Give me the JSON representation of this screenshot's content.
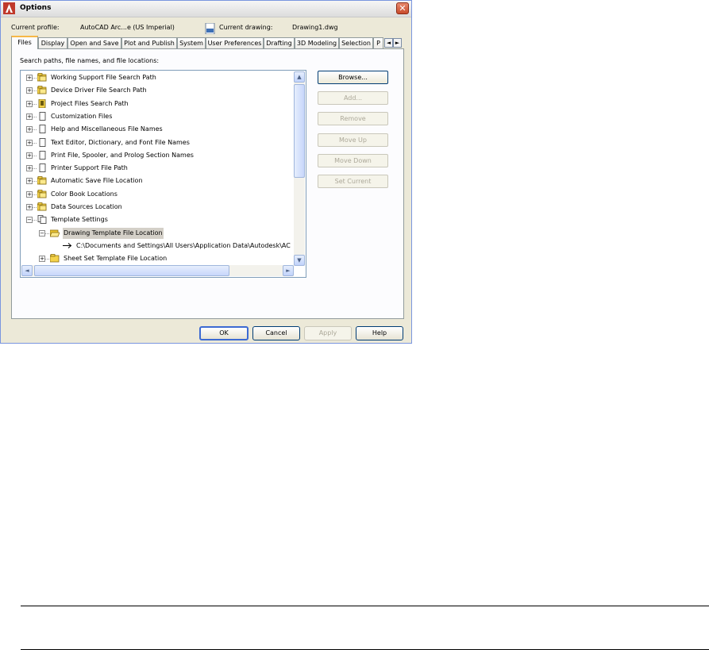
{
  "dialog": {
    "title": "Options",
    "current_profile_label": "Current profile:",
    "current_profile_value": "AutoCAD Arc...e (US Imperial)",
    "current_drawing_label": "Current drawing:",
    "current_drawing_value": "Drawing1.dwg"
  },
  "tabs": [
    "Files",
    "Display",
    "Open and Save",
    "Plot and Publish",
    "System",
    "User Preferences",
    "Drafting",
    "3D Modeling",
    "Selection",
    "P"
  ],
  "tab_scroll": {
    "left": "◄",
    "right": "►"
  },
  "panel": {
    "section_label": "Search paths, file names, and file locations:"
  },
  "tree": [
    {
      "label": "Working Support File Search Path",
      "icon": "folder-stack-icon",
      "expander": "+"
    },
    {
      "label": "Device Driver File Search Path",
      "icon": "folder-stack-icon",
      "expander": "+"
    },
    {
      "label": "Project Files Search Path",
      "icon": "project-file-icon",
      "expander": "+"
    },
    {
      "label": "Customization Files",
      "icon": "document-icon",
      "expander": "+"
    },
    {
      "label": "Help and Miscellaneous File Names",
      "icon": "document-icon",
      "expander": "+"
    },
    {
      "label": "Text Editor, Dictionary, and Font File Names",
      "icon": "document-icon",
      "expander": "+"
    },
    {
      "label": "Print File, Spooler, and Prolog Section Names",
      "icon": "document-icon",
      "expander": "+"
    },
    {
      "label": "Printer Support File Path",
      "icon": "document-icon",
      "expander": "+"
    },
    {
      "label": "Automatic Save File Location",
      "icon": "folder-stack-icon",
      "expander": "+"
    },
    {
      "label": "Color Book Locations",
      "icon": "folder-stack-icon",
      "expander": "+"
    },
    {
      "label": "Data Sources Location",
      "icon": "folder-stack-icon",
      "expander": "+"
    },
    {
      "label": "Template Settings",
      "icon": "template-documents-icon",
      "expander": "−"
    },
    {
      "label": "Drawing Template File Location",
      "icon": "open-folder-icon",
      "expander": "−",
      "selected": true
    },
    {
      "label": "C:\\Documents and Settings\\All Users\\Application Data\\Autodesk\\AC",
      "icon": "arrow-right-icon",
      "expander": ""
    },
    {
      "label": "Sheet Set Template File Location",
      "icon": "folder-icon",
      "expander": "+"
    }
  ],
  "side_buttons": {
    "browse": "Browse...",
    "add": "Add...",
    "remove": "Remove",
    "move_up": "Move Up",
    "move_down": "Move Down",
    "set_current": "Set Current"
  },
  "footer": {
    "ok": "OK",
    "cancel": "Cancel",
    "apply": "Apply",
    "help": "Help"
  },
  "colors": {
    "dialog_bg": "#ece9d8",
    "panel_bg": "#fcfcfe",
    "folder_yellow": "#f4d34a",
    "selection": "#d4d0c8"
  }
}
